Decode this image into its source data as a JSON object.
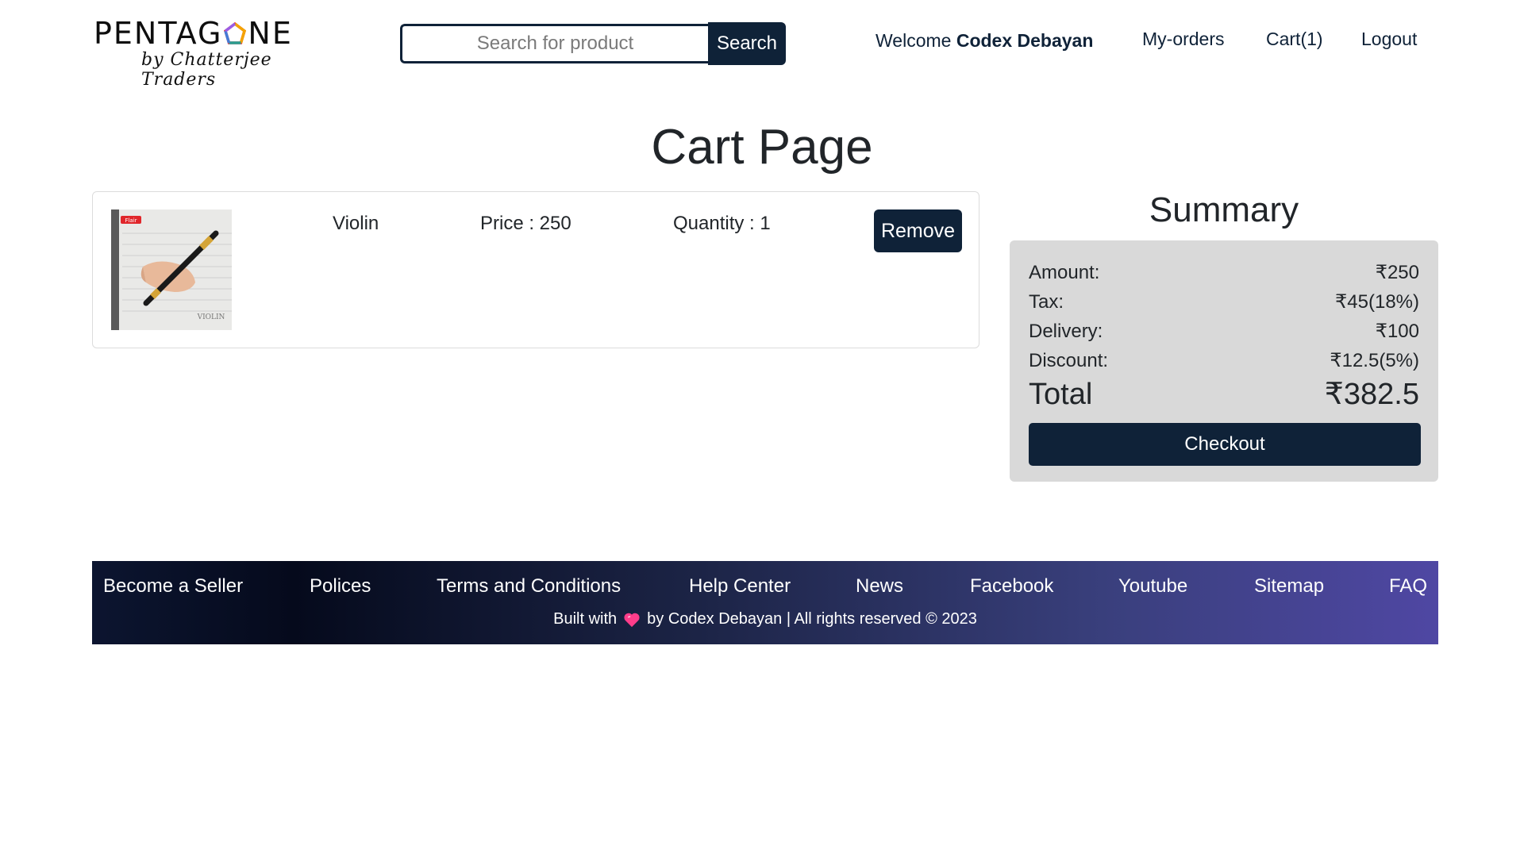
{
  "header": {
    "logo_word_part1": "PENTAG",
    "logo_word_part2": "NE",
    "logo_tagline": "by Chatterjee Traders",
    "search_placeholder": "Search for product",
    "search_button": "Search",
    "welcome_prefix": "Welcome",
    "user_name": "Codex Debayan",
    "nav": {
      "orders": "My-orders",
      "cart": "Cart(1)",
      "logout": "Logout"
    }
  },
  "page": {
    "title": "Cart Page"
  },
  "cart_items": [
    {
      "name": "Violin",
      "price": "Price : 250",
      "quantity": "Quantity : 1",
      "remove_label": "Remove",
      "image_brand_text": "Flair",
      "image_product_text": "VIOLIN"
    }
  ],
  "summary": {
    "title": "Summary",
    "rows": [
      {
        "label": "Amount:",
        "value": "₹250"
      },
      {
        "label": "Tax:",
        "value": "₹45(18%)"
      },
      {
        "label": "Delivery:",
        "value": "₹100"
      },
      {
        "label": "Discount:",
        "value": "₹12.5(5%)"
      }
    ],
    "total_label": "Total",
    "total_value": "₹382.5",
    "checkout_label": "Checkout"
  },
  "footer": {
    "links": [
      "Become a Seller",
      "Polices",
      "Terms and Conditions",
      "Help Center",
      "News",
      "Facebook",
      "Youtube",
      "Sitemap",
      "FAQ"
    ],
    "copy_prefix": "Built with",
    "copy_suffix": "by Codex Debayan | All rights reserved © 2023"
  },
  "colors": {
    "primary": "#0f2238",
    "summary_bg": "#d9d9d9",
    "heart": "#ff3d8b"
  },
  "icons": {
    "logo_mark": "pentagon-icon",
    "heart": "heart-icon"
  }
}
